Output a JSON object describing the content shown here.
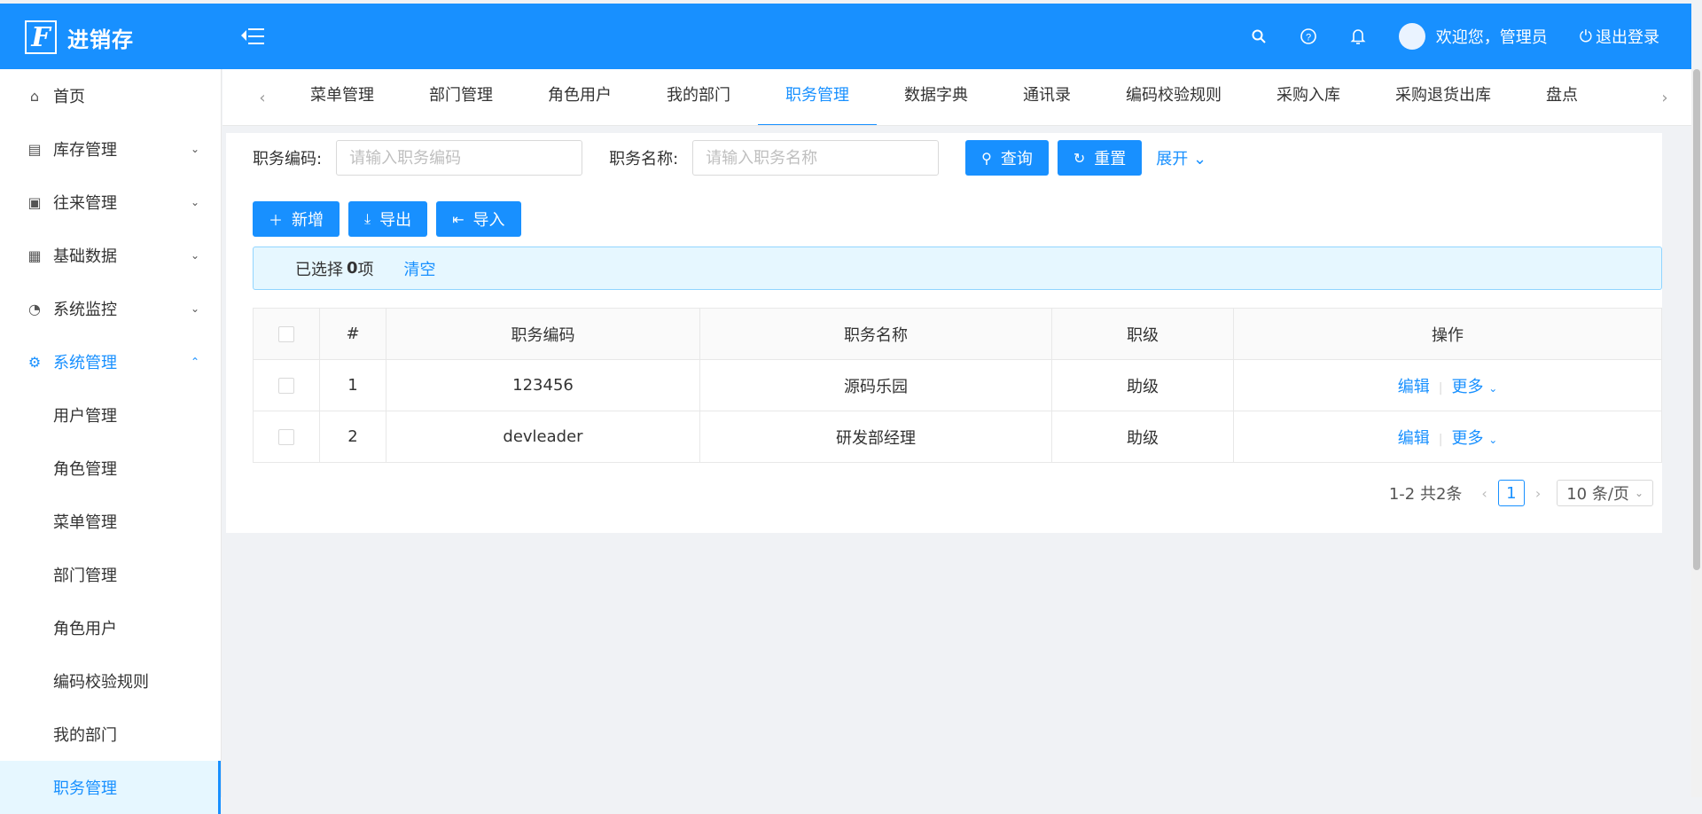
{
  "header": {
    "logo_mark": "F",
    "app_name": "进销存",
    "welcome": "欢迎您，管理员",
    "logout": "退出登录",
    "accent_color": "#1890ff"
  },
  "sidebar": {
    "items": [
      {
        "label": "首页",
        "icon": "home-icon"
      },
      {
        "label": "库存管理",
        "icon": "inventory-icon"
      },
      {
        "label": "往来管理",
        "icon": "contacts-icon"
      },
      {
        "label": "基础数据",
        "icon": "table-icon"
      },
      {
        "label": "系统监控",
        "icon": "dashboard-icon"
      },
      {
        "label": "系统管理",
        "icon": "gear-icon"
      }
    ],
    "sub_items": [
      "用户管理",
      "角色管理",
      "菜单管理",
      "部门管理",
      "角色用户",
      "编码校验规则",
      "我的部门",
      "职务管理"
    ],
    "active_sub": "职务管理"
  },
  "tabs": [
    "菜单管理",
    "部门管理",
    "角色用户",
    "我的部门",
    "职务管理",
    "数据字典",
    "通讯录",
    "编码校验规则",
    "采购入库",
    "采购退货出库",
    "盘点"
  ],
  "active_tab": "职务管理",
  "search": {
    "code_label": "职务编码:",
    "code_placeholder": "请输入职务编码",
    "name_label": "职务名称:",
    "name_placeholder": "请输入职务名称",
    "query": "查询",
    "reset": "重置",
    "expand": "展开"
  },
  "toolbar": {
    "add": "新增",
    "export": "导出",
    "import": "导入"
  },
  "selection": {
    "prefix": "已选择",
    "count": "0",
    "suffix": "项",
    "clear": "清空"
  },
  "table": {
    "headers": [
      "#",
      "职务编码",
      "职务名称",
      "职级",
      "操作"
    ],
    "rows": [
      {
        "index": "1",
        "code": "123456",
        "name": "源码乐园",
        "rank": "助级"
      },
      {
        "index": "2",
        "code": "devleader",
        "name": "研发部经理",
        "rank": "助级"
      }
    ],
    "edit": "编辑",
    "more": "更多"
  },
  "pagination": {
    "summary": "1-2 共2条",
    "current": "1",
    "page_size": "10 条/页"
  }
}
